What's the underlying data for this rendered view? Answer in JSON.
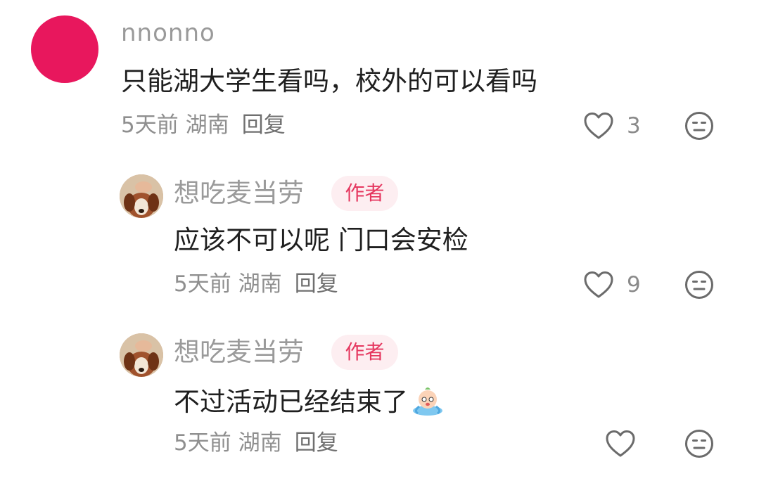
{
  "comments": [
    {
      "username": "nnonno",
      "text": "只能湖大学生看吗，校外的可以看吗",
      "time": "5天前",
      "location": "湖南",
      "reply_label": "回复",
      "like_count": "3",
      "avatar_color": "#e8175d"
    },
    {
      "username": "想吃麦当劳",
      "badge": "作者",
      "text": "应该不可以呢 门口会安检",
      "time": "5天前",
      "location": "湖南",
      "reply_label": "回复",
      "like_count": "9"
    },
    {
      "username": "想吃麦当劳",
      "badge": "作者",
      "text": "不过活动已经结束了",
      "emoji": "crying-emoji",
      "time": "5天前",
      "location": "湖南",
      "reply_label": "回复",
      "like_count": ""
    }
  ],
  "colors": {
    "badge_bg": "#fdeef1",
    "badge_text": "#e5375f",
    "meta_text": "#8f8f8f",
    "icon_stroke": "#6b6b6b"
  },
  "icons": {
    "like": "heart-outline-icon",
    "dislike": "neutral-face-icon"
  }
}
